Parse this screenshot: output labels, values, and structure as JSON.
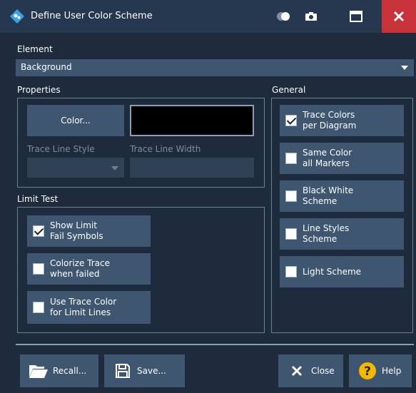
{
  "window": {
    "title": "Define User Color Scheme"
  },
  "element": {
    "label": "Element",
    "selected": "Background"
  },
  "properties": {
    "label": "Properties",
    "color_button": "Color...",
    "swatch_color": "#000000",
    "trace_line_style_label": "Trace Line Style",
    "trace_line_width_label": "Trace Line Width"
  },
  "limit_test": {
    "label": "Limit Test",
    "items": [
      {
        "line1": "Show Limit",
        "line2": "Fail Symbols",
        "checked": true
      },
      {
        "line1": "Colorize Trace",
        "line2": "when failed",
        "checked": false
      },
      {
        "line1": "Use Trace Color",
        "line2": "for Limit Lines",
        "checked": false
      }
    ]
  },
  "general": {
    "label": "General",
    "items": [
      {
        "line1": "Trace Colors",
        "line2": "per Diagram",
        "checked": true
      },
      {
        "line1": "Same Color",
        "line2": "all Markers",
        "checked": false
      },
      {
        "line1": "Black White",
        "line2": "Scheme",
        "checked": false
      },
      {
        "line1": "Line Styles",
        "line2": "Scheme",
        "checked": false
      },
      {
        "line1": "Light Scheme",
        "line2": "",
        "checked": false
      }
    ]
  },
  "footer": {
    "recall": "Recall...",
    "save": "Save...",
    "close": "Close",
    "help": "Help"
  },
  "colors": {
    "titlebar": "#253850",
    "close": "#c8323b",
    "button": "#3e566f",
    "help_icon": "#f5b800"
  }
}
